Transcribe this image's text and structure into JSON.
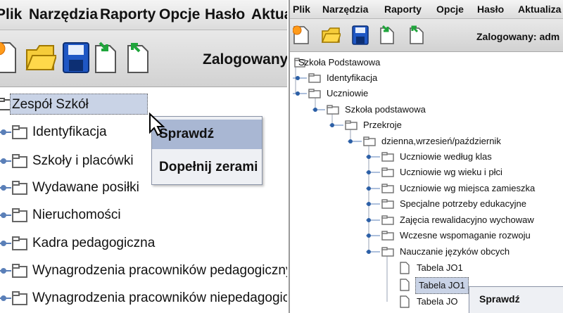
{
  "left": {
    "menu": [
      "Plik",
      "Narzędzia",
      "Raporty",
      "Opcje",
      "Hasło",
      "Aktualiz"
    ],
    "logged_label": "Zalogowany: a",
    "tree": {
      "root": "Zespół Szkół",
      "children": [
        "Identyfikacja",
        "Szkoły i placówki",
        "Wydawane posiłki",
        "Nieruchomości",
        "Kadra pedagogiczna",
        "Wynagrodzenia pracowników pedagogicznych",
        "Wynagrodzenia pracowników niepedagogicznych"
      ]
    },
    "context_menu": [
      "Sprawdź",
      "Dopełnij zerami"
    ]
  },
  "right": {
    "menu": [
      "Plik",
      "Narzędzia",
      "Raporty",
      "Opcje",
      "Hasło",
      "Aktualiza"
    ],
    "logged_label": "Zalogowany: adm",
    "tree": {
      "root": "Szkoła Podstawowa",
      "identyfikacja": "Identyfikacja",
      "uczniowie": "Uczniowie",
      "szkola_podstawowa": "Szkoła podstawowa",
      "przekroje": "Przekroje",
      "dzienna": "dzienna,wrzesień/październik",
      "items": [
        "Uczniowie według klas",
        "Uczniowie wg wieku i płci",
        "Uczniowie wg miejsca zamieszka",
        "Specjalne potrzeby edukacyjne",
        "Zajęcia rewalidacyjno wychowaw",
        "Wczesne wspomaganie rozwoju",
        "Nauczanie języków obcych"
      ],
      "tables": [
        "Tabela JO1",
        "Tabela JO1",
        "Tabela JO"
      ]
    },
    "context_menu": [
      "Sprawdź"
    ]
  },
  "colors": {
    "selection": "#c9d3e6",
    "folder": "#8a8a8a",
    "handle_blue": "#2b5fa6",
    "highlight": "#a9b7d3"
  }
}
